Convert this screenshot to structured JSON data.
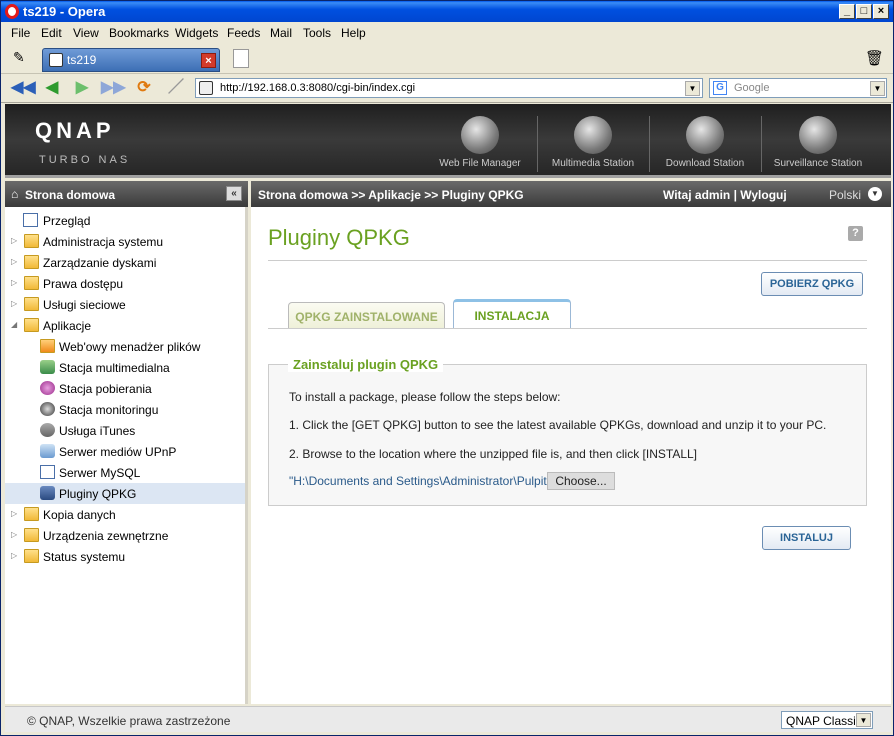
{
  "window": {
    "title": "ts219 - Opera"
  },
  "menu": [
    "File",
    "Edit",
    "View",
    "Bookmarks",
    "Widgets",
    "Feeds",
    "Mail",
    "Tools",
    "Help"
  ],
  "tab": {
    "title": "ts219"
  },
  "address": {
    "url": "http://192.168.0.3:8080/cgi-bin/index.cgi"
  },
  "search": {
    "placeholder": "Google"
  },
  "header": {
    "logo": "QNAP",
    "logo_sub": "Turbo NAS",
    "links": [
      "Web File Manager",
      "Multimedia Station",
      "Download Station",
      "Surveillance Station"
    ]
  },
  "sidebar": {
    "title": "Strona domowa",
    "items": [
      {
        "label": "Przegląd"
      },
      {
        "label": "Administracja systemu"
      },
      {
        "label": "Zarządzanie dyskami"
      },
      {
        "label": "Prawa dostępu"
      },
      {
        "label": "Usługi sieciowe"
      },
      {
        "label": "Aplikacje"
      },
      {
        "label": "Web'owy menadżer plików"
      },
      {
        "label": "Stacja multimedialna"
      },
      {
        "label": "Stacja pobierania"
      },
      {
        "label": "Stacja monitoringu"
      },
      {
        "label": "Usługa iTunes"
      },
      {
        "label": "Serwer mediów UPnP"
      },
      {
        "label": "Serwer MySQL"
      },
      {
        "label": "Pluginy QPKG"
      },
      {
        "label": "Kopia danych"
      },
      {
        "label": "Urządzenia zewnętrzne"
      },
      {
        "label": "Status systemu"
      }
    ]
  },
  "content_header": {
    "breadcrumb": "Strona domowa >> Aplikacje >> Pluginy QPKG",
    "welcome": "Witaj admin | Wyloguj",
    "language": "Polski"
  },
  "main": {
    "title": "Pluginy QPKG",
    "get_button": "POBIERZ QPKG",
    "tabs": [
      "QPKG ZAINSTALOWANE",
      "INSTALACJA"
    ],
    "legend": "Zainstaluj plugin QPKG",
    "intro": "To install a package, please follow the steps below:",
    "step1": "1. Click the [GET QPKG] button to see the latest available QPKGs, download and unzip it to your PC.",
    "step2": "2. Browse to the location where the unzipped file is, and then click [INSTALL]",
    "file_path": "\"H:\\Documents and Settings\\Administrator\\Pulpit",
    "choose_button": "Choose...",
    "install_button": "INSTALUJ"
  },
  "footer": {
    "copyright": "© QNAP, Wszelkie prawa zastrzeżone",
    "skin": "QNAP Classic"
  }
}
